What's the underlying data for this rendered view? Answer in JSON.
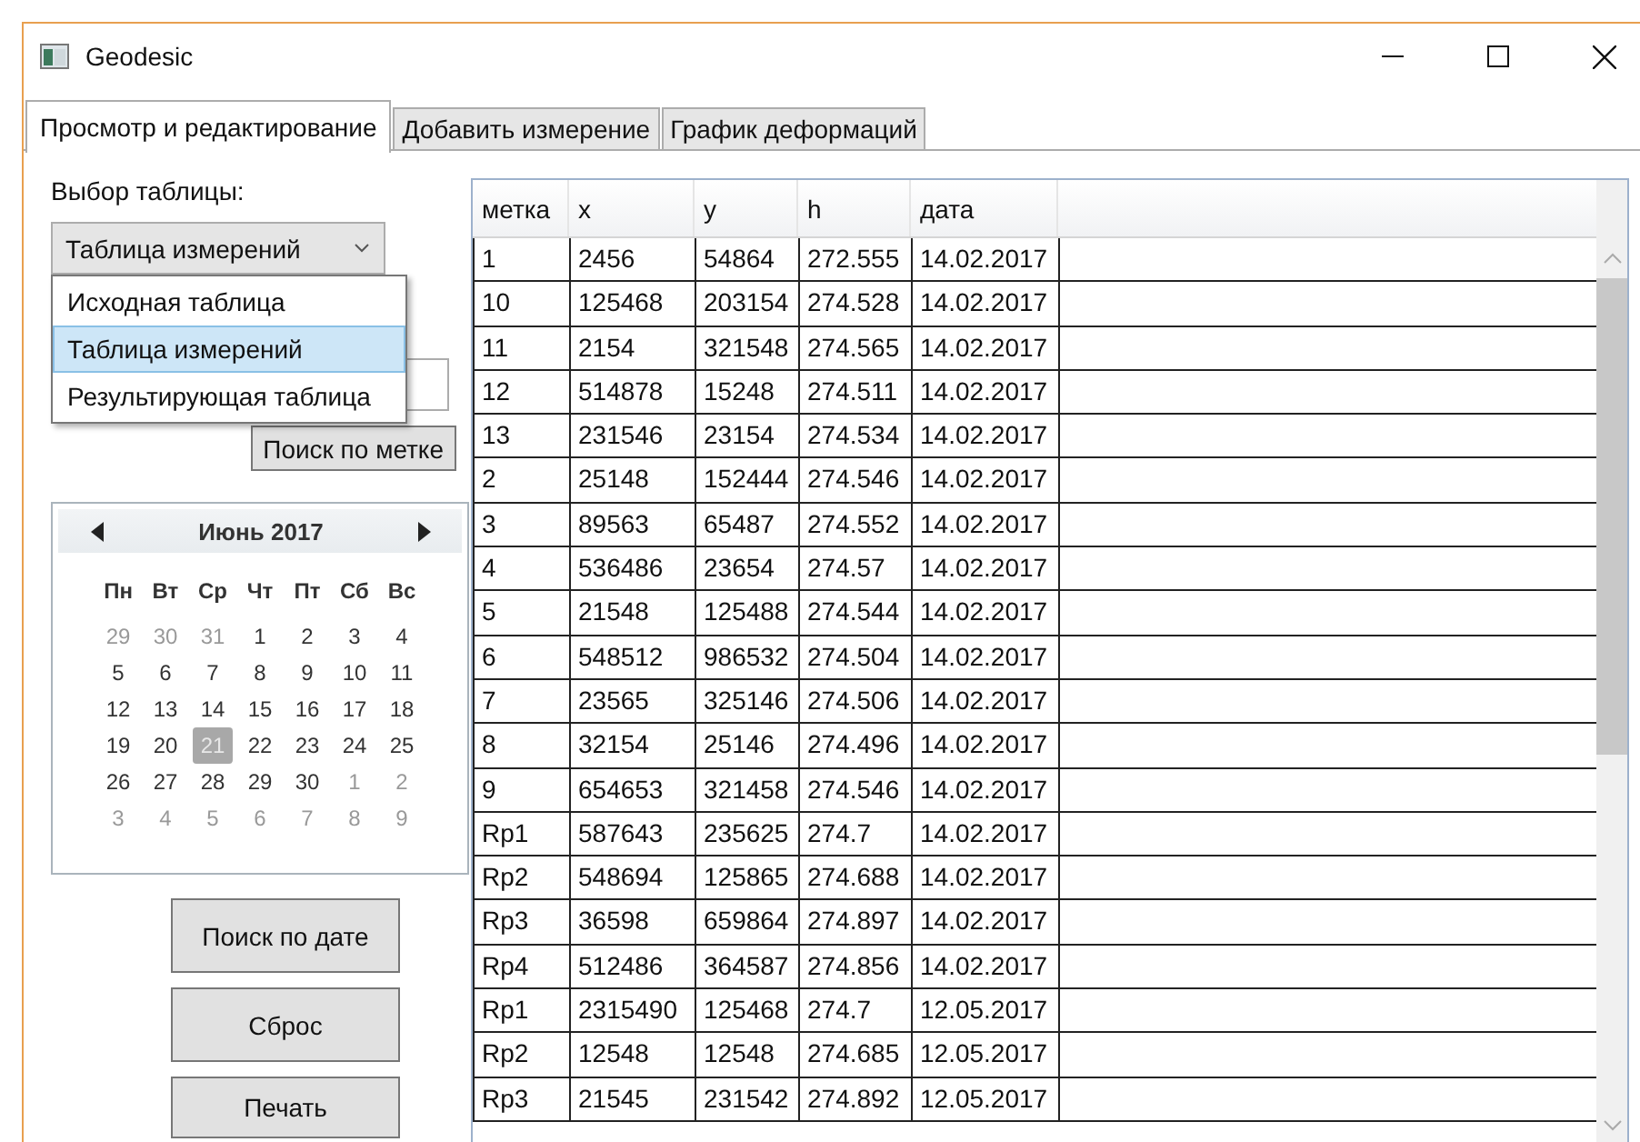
{
  "window": {
    "title": "Geodesic"
  },
  "tabs": [
    {
      "label": "Просмотр и редактирование",
      "selected": true
    },
    {
      "label": "Добавить измерение",
      "selected": false
    },
    {
      "label": "График деформаций",
      "selected": false
    }
  ],
  "table_picker": {
    "label": "Выбор таблицы:",
    "value": "Таблица измерений",
    "expanded": true,
    "options": [
      {
        "label": "Исходная таблица",
        "selected": false
      },
      {
        "label": "Таблица измерений",
        "selected": true
      },
      {
        "label": "Результирующая таблица",
        "selected": false
      }
    ]
  },
  "search_by_mark_button": "Поиск по метке",
  "calendar": {
    "month": "Июнь 2017",
    "weekdays": [
      "Пн",
      "Вт",
      "Ср",
      "Чт",
      "Пт",
      "Сб",
      "Вс"
    ],
    "days": [
      {
        "text": "29",
        "other_month": true,
        "selected": false
      },
      {
        "text": "30",
        "other_month": true,
        "selected": false
      },
      {
        "text": "31",
        "other_month": true,
        "selected": false
      },
      {
        "text": "1",
        "other_month": false,
        "selected": false
      },
      {
        "text": "2",
        "other_month": false,
        "selected": false
      },
      {
        "text": "3",
        "other_month": false,
        "selected": false
      },
      {
        "text": "4",
        "other_month": false,
        "selected": false
      },
      {
        "text": "5",
        "other_month": false,
        "selected": false
      },
      {
        "text": "6",
        "other_month": false,
        "selected": false
      },
      {
        "text": "7",
        "other_month": false,
        "selected": false
      },
      {
        "text": "8",
        "other_month": false,
        "selected": false
      },
      {
        "text": "9",
        "other_month": false,
        "selected": false
      },
      {
        "text": "10",
        "other_month": false,
        "selected": false
      },
      {
        "text": "11",
        "other_month": false,
        "selected": false
      },
      {
        "text": "12",
        "other_month": false,
        "selected": false
      },
      {
        "text": "13",
        "other_month": false,
        "selected": false
      },
      {
        "text": "14",
        "other_month": false,
        "selected": false
      },
      {
        "text": "15",
        "other_month": false,
        "selected": false
      },
      {
        "text": "16",
        "other_month": false,
        "selected": false
      },
      {
        "text": "17",
        "other_month": false,
        "selected": false
      },
      {
        "text": "18",
        "other_month": false,
        "selected": false
      },
      {
        "text": "19",
        "other_month": false,
        "selected": false
      },
      {
        "text": "20",
        "other_month": false,
        "selected": false
      },
      {
        "text": "21",
        "other_month": false,
        "selected": true
      },
      {
        "text": "22",
        "other_month": false,
        "selected": false
      },
      {
        "text": "23",
        "other_month": false,
        "selected": false
      },
      {
        "text": "24",
        "other_month": false,
        "selected": false
      },
      {
        "text": "25",
        "other_month": false,
        "selected": false
      },
      {
        "text": "26",
        "other_month": false,
        "selected": false
      },
      {
        "text": "27",
        "other_month": false,
        "selected": false
      },
      {
        "text": "28",
        "other_month": false,
        "selected": false
      },
      {
        "text": "29",
        "other_month": false,
        "selected": false
      },
      {
        "text": "30",
        "other_month": false,
        "selected": false
      },
      {
        "text": "1",
        "other_month": true,
        "selected": false
      },
      {
        "text": "2",
        "other_month": true,
        "selected": false
      },
      {
        "text": "3",
        "other_month": true,
        "selected": false
      },
      {
        "text": "4",
        "other_month": true,
        "selected": false
      },
      {
        "text": "5",
        "other_month": true,
        "selected": false
      },
      {
        "text": "6",
        "other_month": true,
        "selected": false
      },
      {
        "text": "7",
        "other_month": true,
        "selected": false
      },
      {
        "text": "8",
        "other_month": true,
        "selected": false
      },
      {
        "text": "9",
        "other_month": true,
        "selected": false
      }
    ]
  },
  "buttons": [
    "Поиск по дате",
    "Сброс",
    "Печать"
  ],
  "table": {
    "columns": [
      "метка",
      "x",
      "y",
      "h",
      "дата"
    ],
    "rows": [
      [
        "1",
        "2456",
        "54864",
        "272.555",
        "14.02.2017"
      ],
      [
        "10",
        "125468",
        "203154",
        "274.528",
        "14.02.2017"
      ],
      [
        "11",
        "2154",
        "321548",
        "274.565",
        "14.02.2017"
      ],
      [
        "12",
        "514878",
        "15248",
        "274.511",
        "14.02.2017"
      ],
      [
        "13",
        "231546",
        "23154",
        "274.534",
        "14.02.2017"
      ],
      [
        "2",
        "25148",
        "152444",
        "274.546",
        "14.02.2017"
      ],
      [
        "3",
        "89563",
        "65487",
        "274.552",
        "14.02.2017"
      ],
      [
        "4",
        "536486",
        "23654",
        "274.57",
        "14.02.2017"
      ],
      [
        "5",
        "21548",
        "125488",
        "274.544",
        "14.02.2017"
      ],
      [
        "6",
        "548512",
        "986532",
        "274.504",
        "14.02.2017"
      ],
      [
        "7",
        "23565",
        "325146",
        "274.506",
        "14.02.2017"
      ],
      [
        "8",
        "32154",
        "25146",
        "274.496",
        "14.02.2017"
      ],
      [
        "9",
        "654653",
        "321458",
        "274.546",
        "14.02.2017"
      ],
      [
        "Rp1",
        "587643",
        "235625",
        "274.7",
        "14.02.2017"
      ],
      [
        "Rp2",
        "548694",
        "125865",
        "274.688",
        "14.02.2017"
      ],
      [
        "Rp3",
        "36598",
        "659864",
        "274.897",
        "14.02.2017"
      ],
      [
        "Rp4",
        "512486",
        "364587",
        "274.856",
        "14.02.2017"
      ],
      [
        "Rp1",
        "2315490",
        "125468",
        "274.7",
        "12.05.2017"
      ],
      [
        "Rp2",
        "12548",
        "12548",
        "274.685",
        "12.05.2017"
      ],
      [
        "Rp3",
        "21545",
        "231542",
        "274.892",
        "12.05.2017"
      ]
    ]
  }
}
